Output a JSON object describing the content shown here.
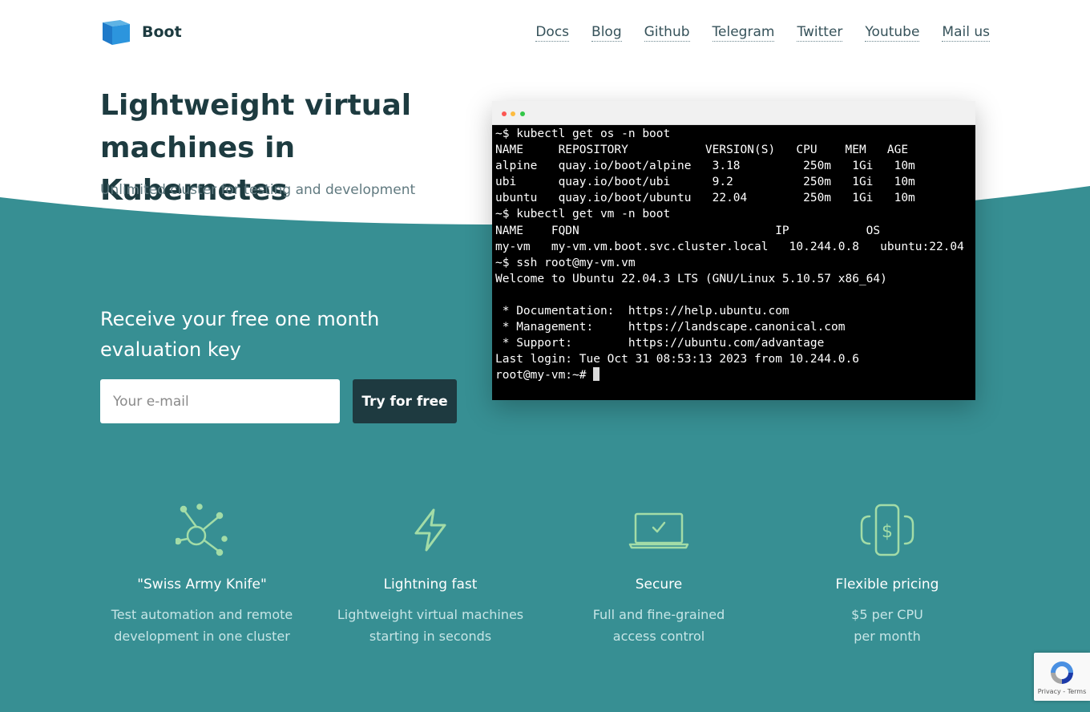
{
  "brand": {
    "name": "Boot",
    "logo_icon": "box-icon"
  },
  "nav": [
    "Docs",
    "Blog",
    "Github",
    "Telegram",
    "Twitter",
    "Youtube",
    "Mail us"
  ],
  "hero": {
    "title": "Lightweight virtual machines in Kubernetes",
    "subtitle": "Unlimited cluster for testing and development"
  },
  "terminal": {
    "lines": [
      "~$ kubectl get os -n boot",
      "NAME     REPOSITORY           VERSION(S)   CPU    MEM   AGE",
      "alpine   quay.io/boot/alpine   3.18         250m   1Gi   10m",
      "ubi      quay.io/boot/ubi      9.2          250m   1Gi   10m",
      "ubuntu   quay.io/boot/ubuntu   22.04        250m   1Gi   10m",
      "~$ kubectl get vm -n boot",
      "NAME    FQDN                            IP           OS",
      "my-vm   my-vm.vm.boot.svc.cluster.local   10.244.0.8   ubuntu:22.04",
      "~$ ssh root@my-vm.vm",
      "Welcome to Ubuntu 22.04.3 LTS (GNU/Linux 5.10.57 x86_64)",
      "",
      " * Documentation:  https://help.ubuntu.com",
      " * Management:     https://landscape.canonical.com",
      " * Support:        https://ubuntu.com/advantage",
      "Last login: Tue Oct 31 08:53:13 2023 from 10.244.0.6"
    ],
    "prompt": "root@my-vm:~# "
  },
  "signup": {
    "title": "Receive your free one month evaluation key",
    "email_placeholder": "Your e-mail",
    "button_label": "Try for free"
  },
  "features": [
    {
      "icon": "network-icon",
      "title": "\"Swiss Army Knife\"",
      "desc1": "Test automation and remote",
      "desc2": "development in one cluster"
    },
    {
      "icon": "lightning-icon",
      "title": "Lightning fast",
      "desc1": "Lightweight virtual machines",
      "desc2": "starting in seconds"
    },
    {
      "icon": "laptop-check-icon",
      "title": "Secure",
      "desc1": "Full and fine-grained",
      "desc2": "access control"
    },
    {
      "icon": "dollar-phone-icon",
      "title": "Flexible pricing",
      "desc1": "$5 per CPU",
      "desc2": "per month"
    }
  ],
  "recaptcha": {
    "links": "Privacy - Terms",
    "icon": "recaptcha-icon"
  },
  "colors": {
    "teal": "#378f93",
    "dark": "#1e3a40",
    "icon_green": "#a3dca7"
  }
}
